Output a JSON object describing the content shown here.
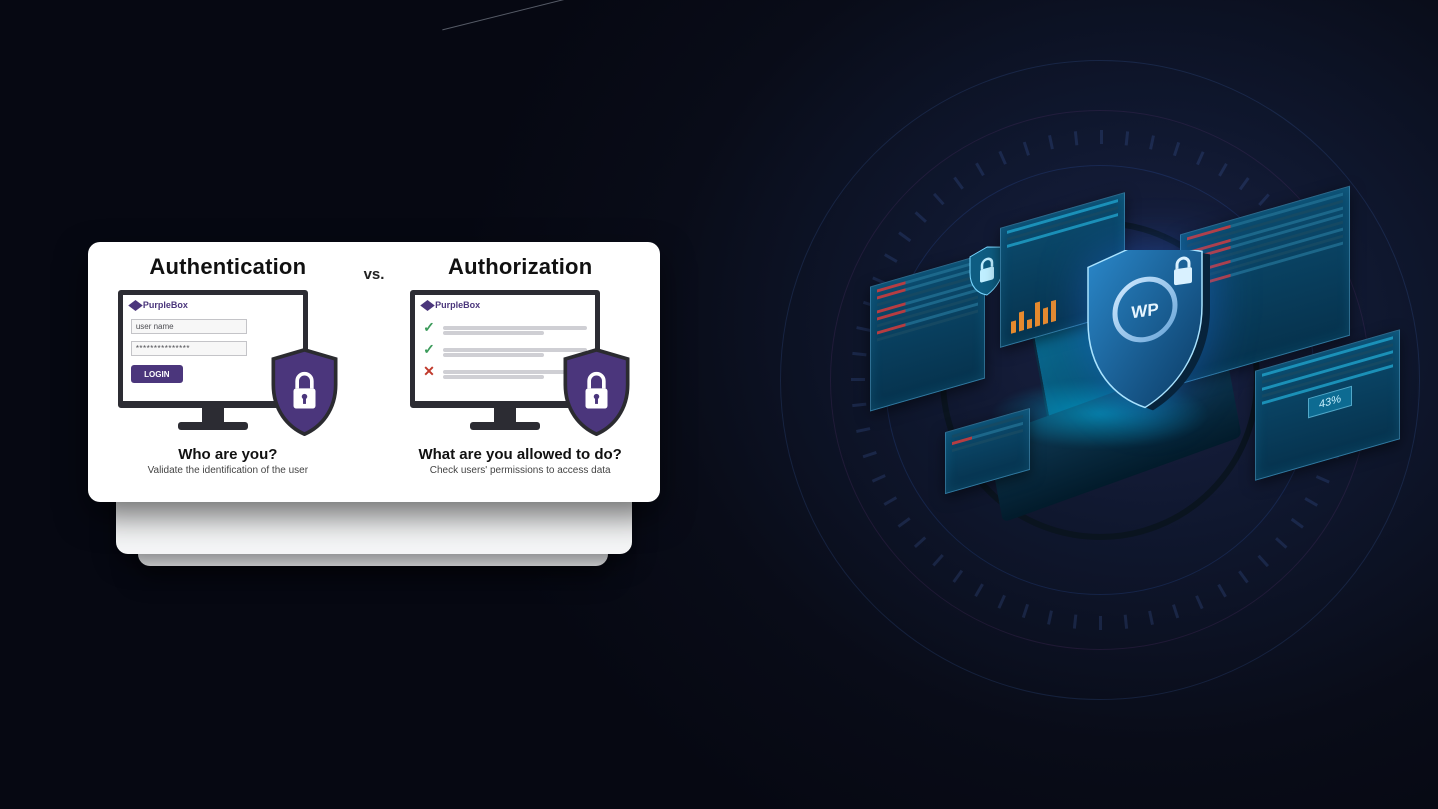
{
  "diagram": {
    "authentication": {
      "heading": "Authentication",
      "brand": "PurpleBox",
      "username_placeholder": "user name",
      "password_masked": "***************",
      "login_button": "LOGIN",
      "question": "Who are you?",
      "subtext": "Validate the identification of the user"
    },
    "vs_label": "vs.",
    "authorization": {
      "heading": "Authorization",
      "brand": "PurpleBox",
      "permission_rows": [
        {
          "status": "allow"
        },
        {
          "status": "allow"
        },
        {
          "status": "deny"
        }
      ],
      "question": "What are you allowed to do?",
      "subtext": "Check users' permissions to access data"
    }
  },
  "decor": {
    "percent_badge": "43%",
    "shield_monogram": "WP"
  },
  "colors": {
    "purple": "#4b367c",
    "green": "#3c9b5b",
    "red": "#c0392b",
    "cyan": "#1f9ec6"
  },
  "icons": {
    "cube": "cube-icon",
    "lock": "lock-icon",
    "shield": "shield-icon",
    "check": "check-icon",
    "cross": "cross-icon"
  }
}
